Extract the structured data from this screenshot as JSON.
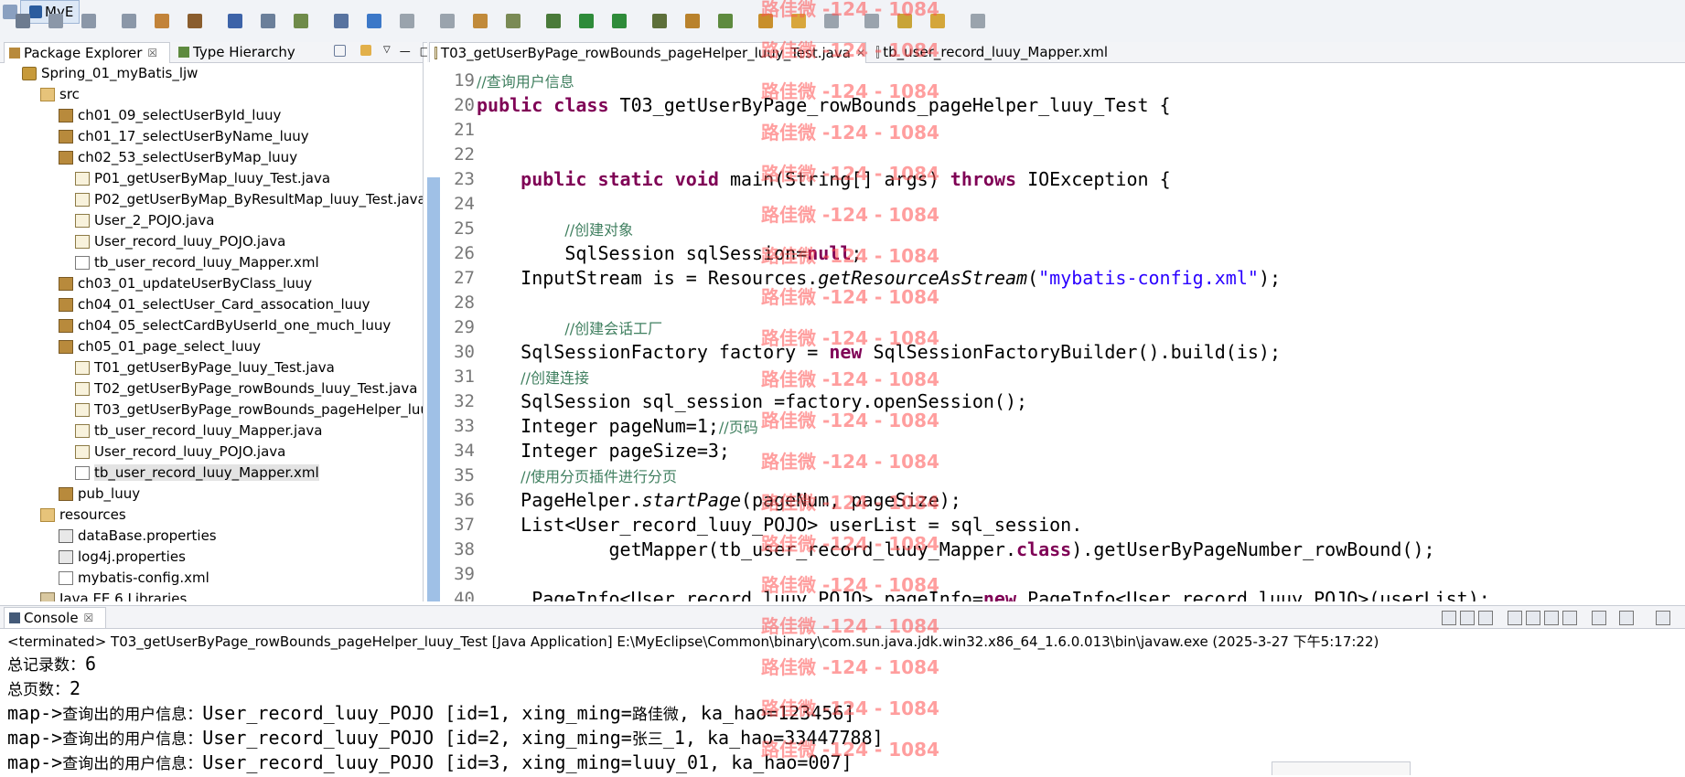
{
  "toolbar": {
    "icons": [
      "new-wizard-icon",
      "save-icon",
      "save-all-icon",
      "print-icon",
      "open-type-icon",
      "new-java-project-icon",
      "new-package-icon",
      "server-icon",
      "deploy-icon",
      "search-icon",
      "browser-icon",
      "back-icon",
      "forward-icon",
      "new-class-icon",
      "open-perspective-icon",
      "debug-icon",
      "run-icon",
      "run-external-icon",
      "coverage-icon",
      "build-icon",
      "refresh-icon",
      "open-folder-icon",
      "task-icon",
      "next-annotation-icon",
      "prev-annotation-icon",
      "last-edit-icon",
      "back-nav-icon",
      "forward-nav-icon"
    ],
    "perspective_label": "MyE"
  },
  "left": {
    "tabs": [
      {
        "label": "Package Explorer",
        "close": "☒"
      },
      {
        "label": "Type Hierarchy"
      }
    ],
    "tree": [
      {
        "label": "Spring_01_myBatis_ljw",
        "type": "project",
        "depth": 0
      },
      {
        "label": "src",
        "type": "src",
        "depth": 1
      },
      {
        "label": "ch01_09_selectUserById_luuy",
        "type": "pkg",
        "depth": 2
      },
      {
        "label": "ch01_17_selectUserByName_luuy",
        "type": "pkg",
        "depth": 2
      },
      {
        "label": "ch02_53_selectUserByMap_luuy",
        "type": "pkg",
        "depth": 2
      },
      {
        "label": "P01_getUserByMap_luuy_Test.java",
        "type": "java",
        "depth": 3
      },
      {
        "label": "P02_getUserByMap_ByResultMap_luuy_Test.java",
        "type": "java",
        "depth": 3
      },
      {
        "label": "User_2_POJO.java",
        "type": "java",
        "depth": 3
      },
      {
        "label": "User_record_luuy_POJO.java",
        "type": "java",
        "depth": 3
      },
      {
        "label": "tb_user_record_luuy_Mapper.xml",
        "type": "xml",
        "depth": 3
      },
      {
        "label": "ch03_01_updateUserByClass_luuy",
        "type": "pkg",
        "depth": 2
      },
      {
        "label": "ch04_01_selectUser_Card_assocation_luuy",
        "type": "pkg",
        "depth": 2
      },
      {
        "label": "ch04_05_selectCardByUserId_one_much_luuy",
        "type": "pkg",
        "depth": 2
      },
      {
        "label": "ch05_01_page_select_luuy",
        "type": "pkg",
        "depth": 2
      },
      {
        "label": "T01_getUserByPage_luuy_Test.java",
        "type": "java",
        "depth": 3
      },
      {
        "label": "T02_getUserByPage_rowBounds_luuy_Test.java",
        "type": "java",
        "depth": 3
      },
      {
        "label": "T03_getUserByPage_rowBounds_pageHelper_luu",
        "type": "java",
        "depth": 3
      },
      {
        "label": "tb_user_record_luuy_Mapper.java",
        "type": "java",
        "depth": 3
      },
      {
        "label": "User_record_luuy_POJO.java",
        "type": "java",
        "depth": 3
      },
      {
        "label": "tb_user_record_luuy_Mapper.xml",
        "type": "xml",
        "depth": 3,
        "selected": true
      },
      {
        "label": "pub_luuy",
        "type": "pkg",
        "depth": 2
      },
      {
        "label": "resources",
        "type": "src",
        "depth": 1
      },
      {
        "label": "dataBase.properties",
        "type": "prop",
        "depth": 2
      },
      {
        "label": "log4j.properties",
        "type": "prop",
        "depth": 2
      },
      {
        "label": "mybatis-config.xml",
        "type": "xml",
        "depth": 2
      },
      {
        "label": "Java EE 6 Libraries",
        "type": "lib",
        "depth": 1
      }
    ]
  },
  "editor": {
    "tabs": [
      {
        "label": "T03_getUserByPage_rowBounds_pageHelper_luuy_Test.java",
        "close": "✕"
      },
      {
        "label": "tb_user_record_luuy_Mapper.xml"
      }
    ],
    "line_numbers": [
      "19",
      "20",
      "21",
      "22",
      "23",
      "24",
      "25",
      "26",
      "27",
      "28",
      "29",
      "30",
      "31",
      "32",
      "33",
      "34",
      "35",
      "36",
      "37",
      "38",
      "39",
      "40"
    ],
    "lines": [
      [
        {
          "t": "//查询用户信息",
          "c": "cm"
        }
      ],
      [
        {
          "t": "public class ",
          "c": "kw"
        },
        {
          "t": "T03_getUserByPage_rowBounds_pageHelper_luuy_Test {"
        }
      ],
      [],
      [],
      [
        {
          "t": "    "
        },
        {
          "t": "public static void ",
          "c": "kw"
        },
        {
          "t": "main(String[] args) "
        },
        {
          "t": "throws ",
          "c": "kw"
        },
        {
          "t": "IOException {"
        }
      ],
      [],
      [
        {
          "t": "        "
        },
        {
          "t": "//创建对象",
          "c": "cm"
        }
      ],
      [
        {
          "t": "        SqlSession sqlSession="
        },
        {
          "t": "null",
          "c": "kw"
        },
        {
          "t": ";"
        }
      ],
      [
        {
          "t": "    InputStream is = Resources."
        },
        {
          "t": "getResourceAsStream",
          "c": "it"
        },
        {
          "t": "("
        },
        {
          "t": "\"mybatis-config.xml\"",
          "c": "st"
        },
        {
          "t": ");"
        }
      ],
      [],
      [
        {
          "t": "        "
        },
        {
          "t": "//创建会话工厂",
          "c": "cm"
        }
      ],
      [
        {
          "t": "    SqlSessionFactory factory = "
        },
        {
          "t": "new ",
          "c": "kw"
        },
        {
          "t": "SqlSessionFactoryBuilder().build(is);"
        }
      ],
      [
        {
          "t": "    "
        },
        {
          "t": "//创建连接",
          "c": "cm"
        }
      ],
      [
        {
          "t": "    SqlSession sql_session =factory.openSession();"
        }
      ],
      [
        {
          "t": "    Integer pageNum=1;"
        },
        {
          "t": "//页码",
          "c": "cm"
        }
      ],
      [
        {
          "t": "    Integer pageSize=3;"
        }
      ],
      [
        {
          "t": "    "
        },
        {
          "t": "//使用分页插件进行分页",
          "c": "cm"
        }
      ],
      [
        {
          "t": "    PageHelper."
        },
        {
          "t": "startPage",
          "c": "it"
        },
        {
          "t": "(pageNum, pageSize);"
        }
      ],
      [
        {
          "t": "    List<User_record_luuy_POJO> userList = sql_session."
        }
      ],
      [
        {
          "t": "            getMapper(tb_user_record_luuy_Mapper."
        },
        {
          "t": "class",
          "c": "kw"
        },
        {
          "t": ").getUserByPageNumber_rowBound();"
        }
      ],
      [],
      [
        {
          "t": "     PageInfo<User_record_luuy_POJO> pageInfo="
        },
        {
          "t": "new ",
          "c": "kw"
        },
        {
          "t": "PageInfo<User_record_luuy_POJO>(userList);"
        }
      ]
    ]
  },
  "console": {
    "tab_label": "Console",
    "tab_close": "☒",
    "status": "<terminated> T03_getUserByPage_rowBounds_pageHelper_luuy_Test [Java Application] E:\\MyEclipse\\Common\\binary\\com.sun.java.jdk.win32.x86_64_1.6.0.013\\bin\\javaw.exe (2025-3-27 下午5:17:22)",
    "output": [
      [
        {
          "t": "总记录数：",
          "c": "cjk"
        },
        {
          "t": "6"
        }
      ],
      [
        {
          "t": "总页数：",
          "c": "cjk"
        },
        {
          "t": "2"
        }
      ],
      [
        {
          "t": "map->"
        },
        {
          "t": "查询出的用户信息：",
          "c": "cjk"
        },
        {
          "t": "User_record_luuy_POJO [id=1, xing_ming="
        },
        {
          "t": "路佳微",
          "c": "cjk"
        },
        {
          "t": ", ka_hao=123456]"
        }
      ],
      [
        {
          "t": "map->"
        },
        {
          "t": "查询出的用户信息：",
          "c": "cjk"
        },
        {
          "t": "User_record_luuy_POJO [id=2, xing_ming="
        },
        {
          "t": "张三",
          "c": "cjk"
        },
        {
          "t": "_1, ka_hao=33447788]"
        }
      ],
      [
        {
          "t": "map->"
        },
        {
          "t": "查询出的用户信息：",
          "c": "cjk"
        },
        {
          "t": "User_record_luuy_POJO [id=3, xing_ming=luuy_01, ka_hao=007]"
        }
      ]
    ]
  },
  "watermark": {
    "text": "路佳微 -124 - 1084",
    "color": "#ff5050"
  }
}
